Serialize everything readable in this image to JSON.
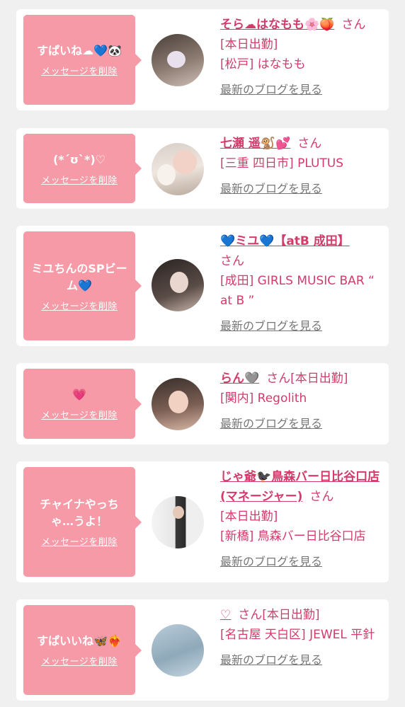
{
  "delete_label": "メッセージを削除",
  "blog_label": "最新のブログを見る",
  "san_label": "さん",
  "cards": [
    {
      "message": "すぱいね☁💙🐼",
      "name": "そら☁はなもも🌸🍑",
      "status": "[本日出勤]",
      "location": "[松戸] はなもも"
    },
    {
      "message": "(*´ʊ`*)♡",
      "name": "七瀬 遥🐒💕",
      "status": "",
      "location": "[三重 四日市] PLUTUS"
    },
    {
      "message": "ミユちんのSPビーム💙",
      "name": "💙ミユ💙【atB 成田】",
      "status": "",
      "location": "[成田] GIRLS MUSIC BAR “ at B ”"
    },
    {
      "message": "💗",
      "name": "らん🩶",
      "status": "[本日出勤]",
      "location": "[関内] Regolith"
    },
    {
      "message": "チャイナやっちゃ…うよ！",
      "name": "じゃ爺🐦‍⬛鳥森バー日比谷口店(マネージャー)",
      "status": "[本日出勤]",
      "location": "[新橋] 鳥森バー日比谷口店"
    },
    {
      "message": "すぱいいね🦋❤️‍🔥",
      "name": "♡",
      "status": "[本日出勤]",
      "location": "[名古屋 天白区] JEWEL 平針"
    }
  ]
}
